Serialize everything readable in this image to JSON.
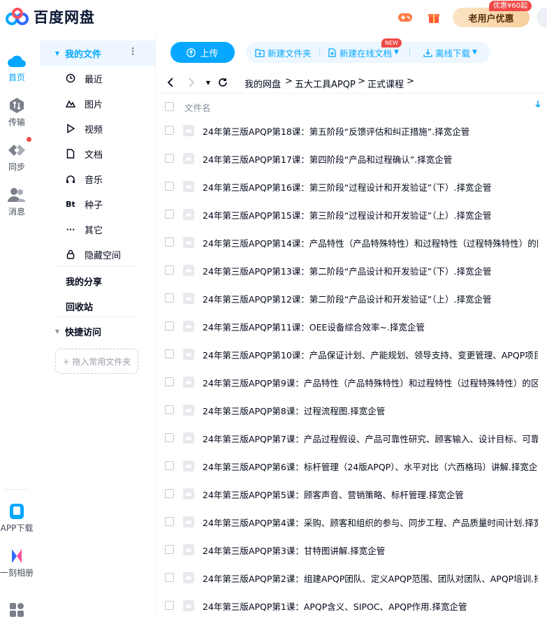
{
  "app": {
    "name": "百度网盘"
  },
  "topbar": {
    "promo_label": "老用户优惠",
    "promo_badge": "优惠¥60起"
  },
  "rail": {
    "items": [
      {
        "label": "首页",
        "icon": "cloud-home-icon",
        "active": true
      },
      {
        "label": "传输",
        "icon": "transfer-icon"
      },
      {
        "label": "同步",
        "icon": "sync-icon"
      },
      {
        "label": "消息",
        "icon": "message-icon"
      },
      {
        "label": "APP下载",
        "icon": "app-download-icon"
      },
      {
        "label": "一刻相册",
        "icon": "album-icon"
      }
    ]
  },
  "sidebar": {
    "my_files": "我的文件",
    "categories": [
      {
        "label": "最近",
        "icon": "clock-icon"
      },
      {
        "label": "图片",
        "icon": "picture-icon"
      },
      {
        "label": "视频",
        "icon": "video-icon"
      },
      {
        "label": "文档",
        "icon": "document-icon"
      },
      {
        "label": "音乐",
        "icon": "music-icon"
      },
      {
        "label": "种子",
        "icon": "bt-icon",
        "glyph": "Bt"
      },
      {
        "label": "其它",
        "icon": "more-icon",
        "glyph": "···"
      },
      {
        "label": "隐藏空间",
        "icon": "lock-icon"
      }
    ],
    "my_share": "我的分享",
    "recycle": "回收站",
    "quick_access": "快捷访问",
    "drop_hint": "+ 拖入常用文件夹"
  },
  "toolbar": {
    "upload": "上传",
    "new_folder": "新建文件夹",
    "new_online_doc": "新建在线文档",
    "new_badge": "NEW",
    "offline_download": "离线下载"
  },
  "breadcrumb": [
    "我的网盘",
    "五大工具APQP",
    "正式课程"
  ],
  "list": {
    "column_name": "文件名",
    "files": [
      "24年第三版APQP第18课：第五阶段“反馈评估和纠正措施”.择宽企管",
      "24年第三版APQP第17课：第四阶段“产品和过程确认”.择宽企管",
      "24年第三版APQP第16课：第三阶段“过程设计和开发验证”（下）.择宽企管",
      "24年第三版APQP第15课：第三阶段“过程设计和开发验证”（上）.择宽企管",
      "24年第三版APQP第14课：产品特性（产品特殊特性）和过程特性（过程特殊特性）的区...",
      "24年第三版APQP第13课：第二阶段“产品设计和开发验证”（下）.择宽企管",
      "24年第三版APQP第12课：第二阶段“产品设计和开发验证”（上）.择宽企管",
      "24年第三版APQP第11课：OEE设备综合效率~.择宽企管",
      "24年第三版APQP第10课：产品保证计划、产能规划、领导支持、变更管理、APQP项目...",
      "24年第三版APQP第9课：产品特性（产品特殊特性）和过程特性（过程特殊特性）的区...",
      "24年第三版APQP第8课：过程流程图.择宽企管",
      "24年第三版APQP第7课：产品过程假设、产品可靠性研究、顾客输入、设计目标、可靠...",
      "24年第三版APQP第6课：标杆管理（24版APQP）、水平对比（六西格玛）讲解.择宽企管",
      "24年第三版APQP第5课：顾客声音、营销策略、标杆管理.择宽企管",
      "24年第三版APQP第4课：采购、顾客和组织的参与、同步工程、产品质量时间计划.择宽...",
      "24年第三版APQP第3课：甘特图讲解.择宽企管",
      "24年第三版APQP第2课：组建APQP团队、定义APQP范围、团队对团队、APQP培训.择...",
      "24年第三版APQP第1课：APQP含义、SIPOC、APQP作用.择宽企管"
    ]
  },
  "colors": {
    "accent": "#06a7ff",
    "accent_light": "#eef7ff",
    "badge_red": "#f04a47",
    "text": "#03081a"
  }
}
